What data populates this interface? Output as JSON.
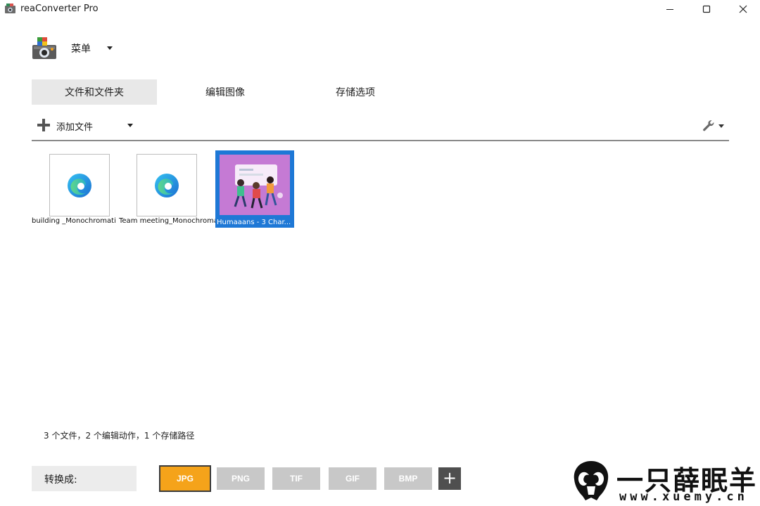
{
  "window": {
    "title": "reaConverter Pro",
    "controls": [
      "minimize-icon",
      "maximize-icon",
      "close-icon"
    ]
  },
  "menu": {
    "label": "菜单"
  },
  "tabs": [
    {
      "label": "文件和文件夹",
      "active": true
    },
    {
      "label": "编辑图像",
      "active": false
    },
    {
      "label": "存储选项",
      "active": false
    }
  ],
  "toolbar": {
    "add_label": "添加文件",
    "settings_icon": "wrench-icon"
  },
  "files": [
    {
      "name": "building _Monochromatic.svg",
      "thumb": "edge-icon",
      "selected": false
    },
    {
      "name": "Team meeting_Monochromatic.svg",
      "thumb": "edge-icon",
      "selected": false
    },
    {
      "name": "Humaaans - 3 Char...",
      "thumb": "illustration-thumbnail",
      "selected": true
    }
  ],
  "status": "3 个文件，2 个编辑动作，1 个存储路径",
  "convert": {
    "label": "转换成:",
    "formats": [
      {
        "label": "JPG",
        "active": true
      },
      {
        "label": "PNG",
        "active": false
      },
      {
        "label": "TIF",
        "active": false
      },
      {
        "label": "GIF",
        "active": false
      },
      {
        "label": "BMP",
        "active": false
      }
    ],
    "add_label": "+"
  },
  "watermark": {
    "text": "一只薛眠羊",
    "url": "www.xuemy.cn"
  },
  "colors": {
    "active_format": "#f5a31a",
    "inactive_format": "#c8c8c8",
    "selection": "#1e78d6",
    "tab_active": "#e8e8e8"
  }
}
